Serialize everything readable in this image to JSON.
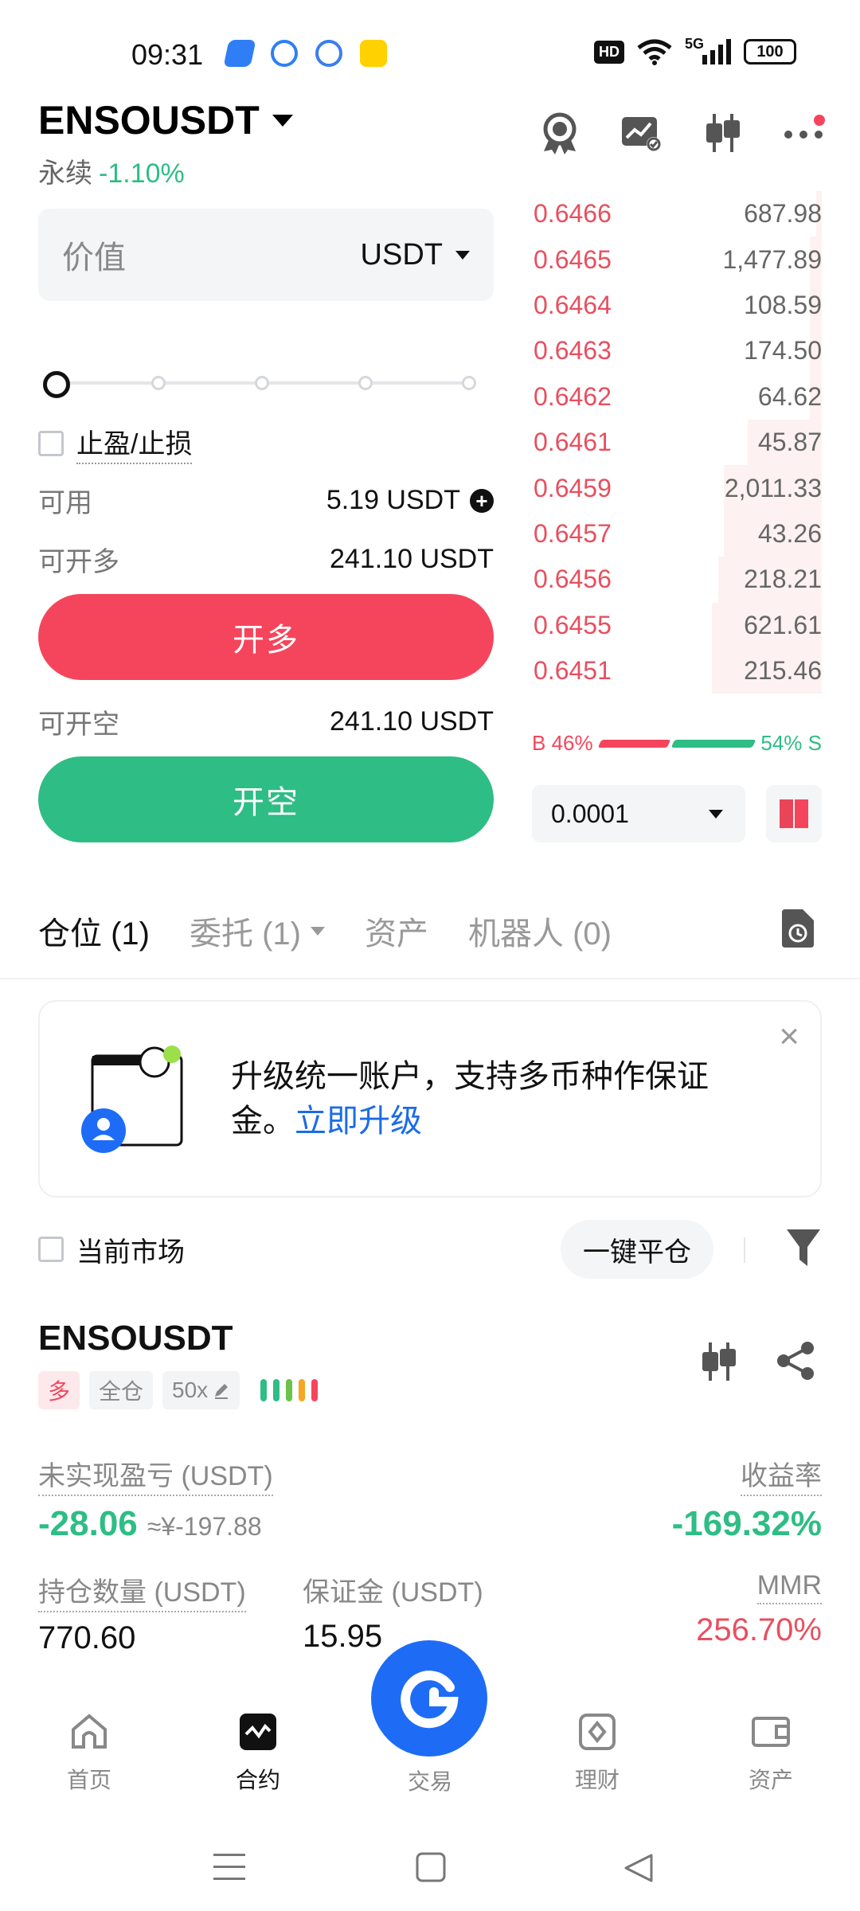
{
  "status_bar": {
    "time": "09:31",
    "hd": "HD",
    "network": "5G",
    "battery": "100"
  },
  "header": {
    "symbol": "ENSOUSDT",
    "contract_type": "永续",
    "change": "-1.10%",
    "icons": [
      "badge-icon",
      "chart-check-icon",
      "candlestick-icon",
      "more-icon"
    ]
  },
  "order_form": {
    "value_placeholder": "价值",
    "unit": "USDT",
    "slider_percent": 0,
    "tpsl_label": "止盈/止损",
    "available_label": "可用",
    "available_value": "5.19 USDT",
    "max_long_label": "可开多",
    "max_long_value": "241.10 USDT",
    "long_button": "开多",
    "max_short_label": "可开空",
    "max_short_value": "241.10 USDT",
    "short_button": "开空"
  },
  "orderbook": {
    "asks": [
      {
        "price": "0.6466",
        "qty": "687.98",
        "depth": 0.02
      },
      {
        "price": "0.6465",
        "qty": "1,477.89",
        "depth": 0.04
      },
      {
        "price": "0.6464",
        "qty": "108.59",
        "depth": 0.04
      },
      {
        "price": "0.6463",
        "qty": "174.50",
        "depth": 0.04
      },
      {
        "price": "0.6462",
        "qty": "64.62",
        "depth": 0.04
      },
      {
        "price": "0.6461",
        "qty": "45.87",
        "depth": 0.25
      },
      {
        "price": "0.6459",
        "qty": "2,011.33",
        "depth": 0.33
      },
      {
        "price": "0.6457",
        "qty": "43.26",
        "depth": 0.33
      },
      {
        "price": "0.6456",
        "qty": "218.21",
        "depth": 0.35
      },
      {
        "price": "0.6455",
        "qty": "621.61",
        "depth": 0.37
      },
      {
        "price": "0.6451",
        "qty": "215.46",
        "depth": 0.37
      }
    ],
    "buy_label": "B 46%",
    "sell_label": "54% S",
    "buy_ratio": 46,
    "sell_ratio": 54,
    "precision": "0.0001"
  },
  "tabs": [
    {
      "label": "仓位 (1)",
      "active": true
    },
    {
      "label": "委托 (1)",
      "active": false,
      "dropdown": true
    },
    {
      "label": "资产",
      "active": false
    },
    {
      "label": "机器人 (0)",
      "active": false
    }
  ],
  "banner": {
    "text": "升级统一账户，支持多币种作保证金。",
    "link": "立即升级"
  },
  "filter": {
    "current_market": "当前市场",
    "close_all": "一键平仓"
  },
  "position": {
    "symbol": "ENSOUSDT",
    "side_tag": "多",
    "margin_mode": "全仓",
    "leverage": "50x",
    "unrealized_pnl_label": "未实现盈亏 (USDT)",
    "unrealized_pnl": "-28.06",
    "unrealized_pnl_cny": "≈¥-197.88",
    "roe_label": "收益率",
    "roe": "-169.32%",
    "size_label": "持仓数量 (USDT)",
    "size": "770.60",
    "margin_label": "保证金 (USDT)",
    "margin": "15.95",
    "mmr_label": "MMR",
    "mmr": "256.70%"
  },
  "bottom_nav": [
    {
      "label": "首页",
      "icon": "home-icon"
    },
    {
      "label": "合约",
      "icon": "futures-icon"
    },
    {
      "label": "交易",
      "icon": "trade-icon"
    },
    {
      "label": "理财",
      "icon": "earn-icon"
    },
    {
      "label": "资产",
      "icon": "wallet-icon"
    }
  ],
  "colors": {
    "red": "#f5455c",
    "green": "#2ebd85",
    "blue": "#1e6cf5",
    "link": "#1b6ce6"
  }
}
